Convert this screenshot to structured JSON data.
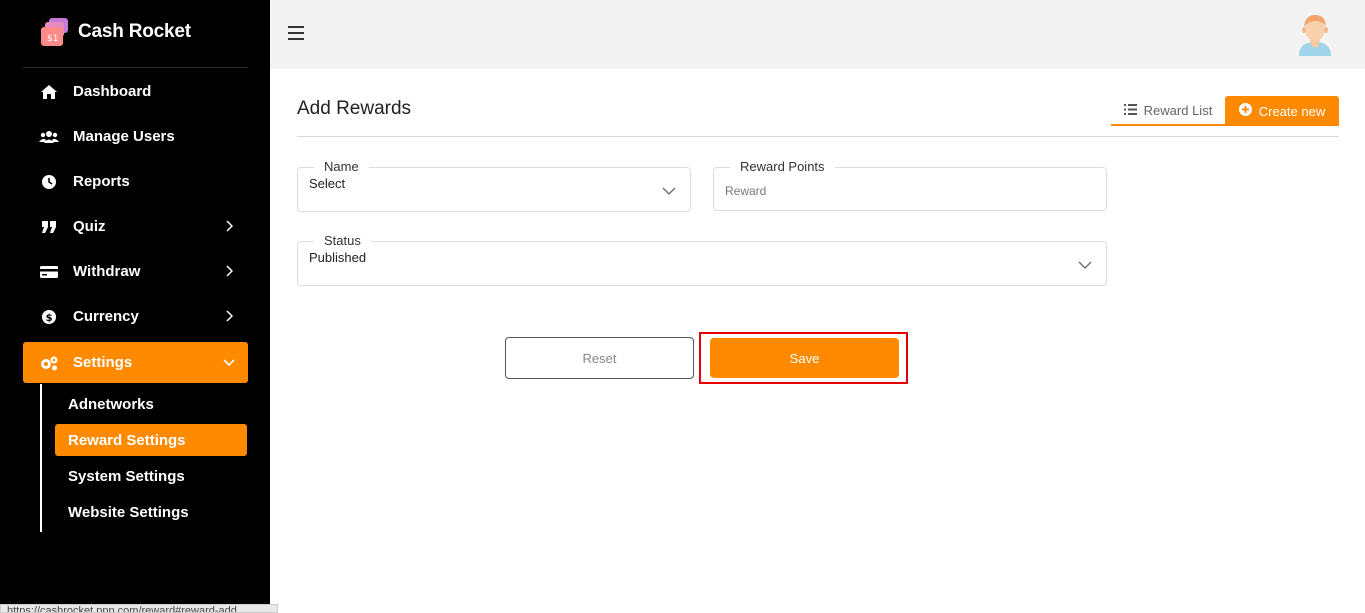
{
  "brand": {
    "name": "Cash Rocket",
    "accent": "#ff8a00"
  },
  "sidebar": {
    "items": [
      {
        "label": "Dashboard",
        "icon": "home-icon",
        "has_chevron": false
      },
      {
        "label": "Manage Users",
        "icon": "users-icon",
        "has_chevron": false
      },
      {
        "label": "Reports",
        "icon": "clock-icon",
        "has_chevron": false
      },
      {
        "label": "Quiz",
        "icon": "quote-icon",
        "has_chevron": true
      },
      {
        "label": "Withdraw",
        "icon": "credit-card-icon",
        "has_chevron": true
      },
      {
        "label": "Currency",
        "icon": "dollar-circle-icon",
        "has_chevron": true
      },
      {
        "label": "Settings",
        "icon": "gears-icon",
        "has_chevron": true,
        "active": true,
        "expanded": true
      }
    ],
    "settings_submenu": [
      {
        "label": "Adnetworks"
      },
      {
        "label": "Reward Settings",
        "active": true
      },
      {
        "label": "System Settings"
      },
      {
        "label": "Website Settings"
      }
    ]
  },
  "header": {
    "menu_icon": "hamburger-icon",
    "avatar_icon": "user-avatar-icon"
  },
  "main": {
    "title": "Add Rewards",
    "tabs": [
      {
        "label": "Reward List",
        "icon": "list-icon"
      },
      {
        "label": "Create new",
        "icon": "plus-circle-icon",
        "active": true
      }
    ],
    "form": {
      "name": {
        "legend": "Name",
        "value": "Select"
      },
      "reward_points": {
        "legend": "Reward Points",
        "placeholder": "Reward"
      },
      "status": {
        "legend": "Status",
        "value": "Published"
      }
    },
    "buttons": {
      "reset": "Reset",
      "save": "Save"
    }
  },
  "status_bar": {
    "url": "https://cashrocket.ppp.com/reward#reward-add"
  }
}
